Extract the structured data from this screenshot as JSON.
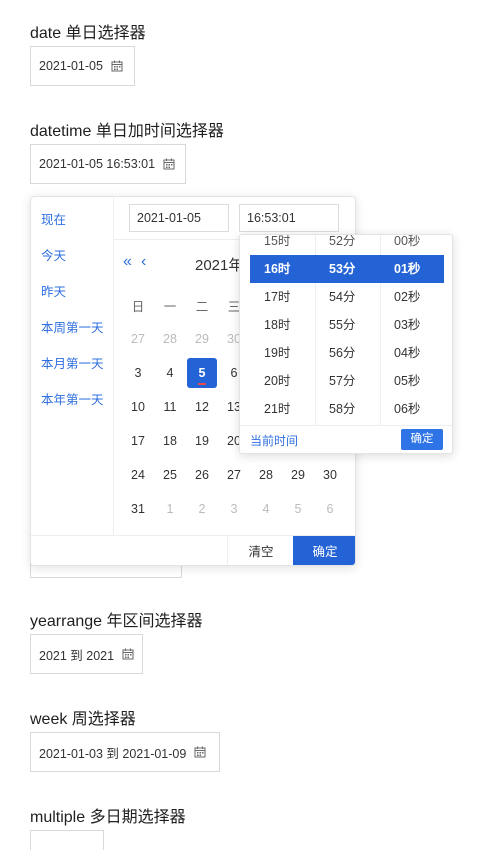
{
  "sections": {
    "date": {
      "title": "date 单日选择器",
      "value": "2021-01-05"
    },
    "datetime": {
      "title": "datetime 单日加时间选择器",
      "value": "2021-01-05 16:53:01"
    },
    "yearrange": {
      "title": "yearrange 年区间选择器",
      "value": "2021 到 2021"
    },
    "week": {
      "title": "week 周选择器",
      "value": "2021-01-03 到 2021-01-09"
    },
    "multiple": {
      "title": "multiple 多日期选择器"
    }
  },
  "picker": {
    "shortcuts": [
      "现在",
      "今天",
      "昨天",
      "本周第一天",
      "本月第一天",
      "本年第一天"
    ],
    "date_input": "2021-01-05",
    "time_input": "16:53:01",
    "nav_prev_year": "«",
    "nav_prev_month": "‹",
    "month_title": "2021年",
    "weekdays": [
      "日",
      "一",
      "二",
      "三"
    ],
    "rows": [
      [
        "27",
        "28",
        "29",
        "30"
      ],
      [
        "3",
        "4",
        "5",
        "6"
      ],
      [
        "10",
        "11",
        "12",
        "13"
      ],
      [
        "17",
        "18",
        "19",
        "20"
      ],
      [
        "24",
        "25",
        "26",
        "27",
        "28",
        "29",
        "30"
      ],
      [
        "31",
        "1",
        "2",
        "3",
        "4",
        "5",
        "6"
      ]
    ],
    "selected_day": "5",
    "clear_label": "清空",
    "ok_label": "确定"
  },
  "time_panel": {
    "hours": [
      "15时",
      "16时",
      "17时",
      "18时",
      "19时",
      "20时",
      "21时"
    ],
    "minutes": [
      "52分",
      "53分",
      "54分",
      "55分",
      "56分",
      "57分",
      "58分"
    ],
    "seconds": [
      "00秒",
      "01秒",
      "02秒",
      "03秒",
      "04秒",
      "05秒",
      "06秒"
    ],
    "selected": {
      "hour": "16时",
      "minute": "53分",
      "second": "01秒"
    },
    "now_label": "当前时间",
    "ok_label": "确定"
  },
  "colors": {
    "primary": "#2463d6",
    "link": "#2f6fe0",
    "today_mark": "#e54b4b"
  },
  "icons": {
    "calendar": "calendar-icon"
  }
}
